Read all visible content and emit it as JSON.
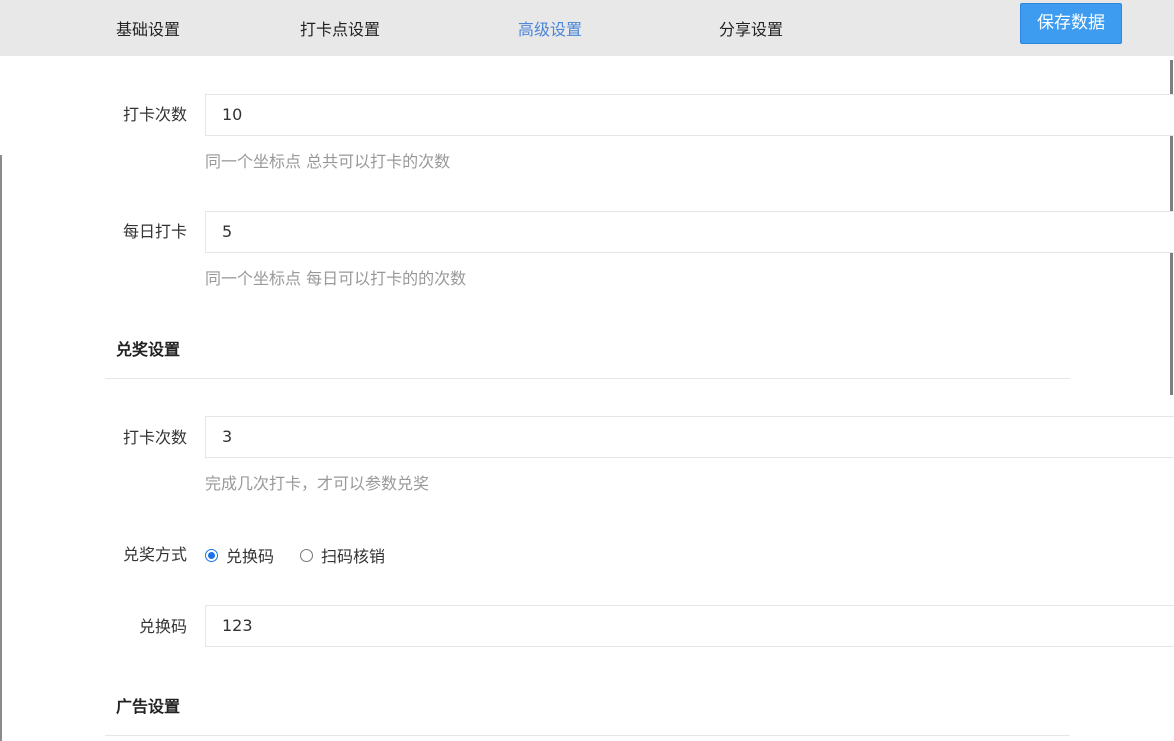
{
  "tabs": [
    {
      "label": "基础设置"
    },
    {
      "label": "打卡点设置"
    },
    {
      "label": "高级设置"
    },
    {
      "label": "分享设置"
    }
  ],
  "active_tab": "高级设置",
  "save_button": {
    "label": "保存数据"
  },
  "checkin": {
    "times": {
      "label": "打卡次数",
      "value": "10",
      "hint": "同一个坐标点 总共可以打卡的次数"
    },
    "daily": {
      "label": "每日打卡",
      "value": "5",
      "hint": "同一个坐标点 每日可以打卡的的次数"
    }
  },
  "prize": {
    "section_title": "兑奖设置",
    "times": {
      "label": "打卡次数",
      "value": "3",
      "hint": "完成几次打卡，才可以参数兑奖"
    },
    "method": {
      "label": "兑奖方式",
      "options": [
        {
          "label": "兑换码",
          "checked": true
        },
        {
          "label": "扫码核销",
          "checked": false
        }
      ]
    },
    "code": {
      "label": "兑换码",
      "value": "123"
    }
  },
  "ad": {
    "section_title": "广告设置"
  },
  "colors": {
    "accent": "#3d9cf0",
    "active_tab": "#4d86d9",
    "radio": "#1a73e8"
  }
}
